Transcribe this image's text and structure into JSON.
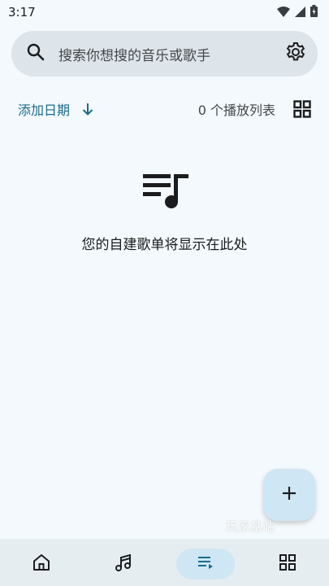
{
  "status_bar": {
    "time": "3:17",
    "icons": [
      "wifi-icon",
      "signal-icon",
      "battery-icon"
    ]
  },
  "search": {
    "placeholder": "搜索你想搜的音乐或歌手",
    "icons": [
      "search-icon",
      "settings-icon"
    ]
  },
  "toolbar": {
    "sort_label": "添加日期",
    "sort_direction_icon": "arrow-down-icon",
    "count_label": "0 个播放列表",
    "view_toggle_icon": "grid-view-icon"
  },
  "empty_state": {
    "icon": "playlist-music-icon",
    "message": "您的自建歌单将显示在此处"
  },
  "fab": {
    "icon": "plus-icon"
  },
  "watermark": "玩家基站",
  "bottom_nav": {
    "items": [
      {
        "icon": "home-icon",
        "active": false
      },
      {
        "icon": "music-note-icon",
        "active": false
      },
      {
        "icon": "playlist-icon",
        "active": true
      },
      {
        "icon": "grid-icon",
        "active": false
      }
    ]
  },
  "colors": {
    "background": "#f3f9fc",
    "search_bg": "#dde4ea",
    "accent_text": "#1a6b8a",
    "fab_bg": "#cfe6f4",
    "nav_bg": "#e6edf1",
    "nav_active": "#cfe6f4"
  }
}
